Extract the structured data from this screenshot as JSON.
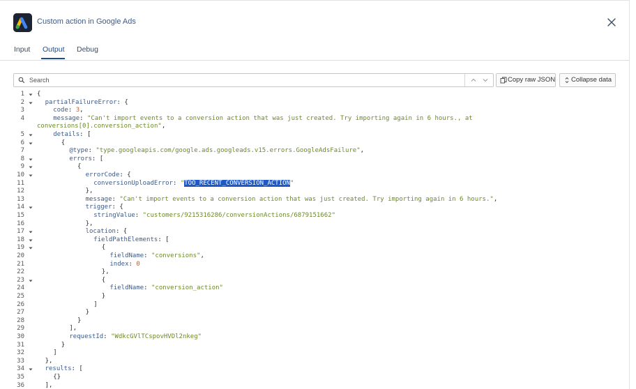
{
  "window": {
    "title": "Custom action in Google Ads",
    "app_icon": "google-ads-icon",
    "close_icon": "close-icon"
  },
  "tabs": [
    {
      "label": "Input",
      "active": false
    },
    {
      "label": "Output",
      "active": true
    },
    {
      "label": "Debug",
      "active": false
    }
  ],
  "toolbar": {
    "search_placeholder": "Search",
    "copy_label": "Copy raw JSON",
    "collapse_label": "Collapse data"
  },
  "colors": {
    "accent": "#1f4d8a",
    "key": "#3c5a87",
    "string": "#6b8a26",
    "number": "#c25b2a",
    "highlight": "#1f59c4"
  },
  "code_lines": [
    {
      "n": "1",
      "fold": true,
      "i": 0,
      "t": [
        [
          "p",
          "{"
        ]
      ]
    },
    {
      "n": "2",
      "fold": true,
      "i": 1,
      "t": [
        [
          "k",
          "partialFailureError"
        ],
        [
          "p",
          ": {"
        ]
      ]
    },
    {
      "n": "3",
      "fold": false,
      "i": 2,
      "t": [
        [
          "k",
          "code"
        ],
        [
          "p",
          ": "
        ],
        [
          "n",
          "3"
        ],
        [
          "p",
          ","
        ]
      ]
    },
    {
      "n": "4",
      "fold": false,
      "i": 2,
      "t": [
        [
          "k",
          "message"
        ],
        [
          "p",
          ": "
        ],
        [
          "s",
          "\"Can't import events to a conversion action that was just created. Try importing again in 6 hours., at"
        ]
      ]
    },
    {
      "n": "",
      "fold": false,
      "i": 0,
      "t": [
        [
          "s",
          "conversions[0].conversion_action\""
        ],
        [
          "p",
          ","
        ]
      ]
    },
    {
      "n": "5",
      "fold": true,
      "i": 2,
      "t": [
        [
          "k",
          "details"
        ],
        [
          "p",
          ": ["
        ]
      ]
    },
    {
      "n": "6",
      "fold": true,
      "i": 3,
      "t": [
        [
          "p",
          "{"
        ]
      ]
    },
    {
      "n": "7",
      "fold": false,
      "i": 4,
      "t": [
        [
          "k",
          "@type"
        ],
        [
          "p",
          ": "
        ],
        [
          "s",
          "\"type.googleapis.com/google.ads.googleads.v15.errors.GoogleAdsFailure\""
        ],
        [
          "p",
          ","
        ]
      ]
    },
    {
      "n": "8",
      "fold": true,
      "i": 4,
      "t": [
        [
          "k",
          "errors"
        ],
        [
          "p",
          ": ["
        ]
      ]
    },
    {
      "n": "9",
      "fold": true,
      "i": 5,
      "t": [
        [
          "p",
          "{"
        ]
      ]
    },
    {
      "n": "10",
      "fold": true,
      "i": 6,
      "t": [
        [
          "k",
          "errorCode"
        ],
        [
          "p",
          ": {"
        ]
      ]
    },
    {
      "n": "11",
      "fold": false,
      "i": 7,
      "t": [
        [
          "k",
          "conversionUploadError"
        ],
        [
          "p",
          ": "
        ],
        [
          "s",
          "\""
        ],
        [
          "h",
          "TOO_RECENT_CONVERSION_ACTION"
        ],
        [
          "s",
          "\""
        ]
      ]
    },
    {
      "n": "12",
      "fold": false,
      "i": 6,
      "t": [
        [
          "p",
          "},"
        ]
      ]
    },
    {
      "n": "13",
      "fold": false,
      "i": 6,
      "t": [
        [
          "k",
          "message"
        ],
        [
          "p",
          ": "
        ],
        [
          "s",
          "\"Can't import events to a conversion action that was just created. Try importing again in 6 hours.\""
        ],
        [
          "p",
          ","
        ]
      ]
    },
    {
      "n": "14",
      "fold": true,
      "i": 6,
      "t": [
        [
          "k",
          "trigger"
        ],
        [
          "p",
          ": {"
        ]
      ]
    },
    {
      "n": "15",
      "fold": false,
      "i": 7,
      "t": [
        [
          "k",
          "stringValue"
        ],
        [
          "p",
          ": "
        ],
        [
          "s",
          "\"customers/9215316286/conversionActions/6879151662\""
        ]
      ]
    },
    {
      "n": "16",
      "fold": false,
      "i": 6,
      "t": [
        [
          "p",
          "},"
        ]
      ]
    },
    {
      "n": "17",
      "fold": true,
      "i": 6,
      "t": [
        [
          "k",
          "location"
        ],
        [
          "p",
          ": {"
        ]
      ]
    },
    {
      "n": "18",
      "fold": true,
      "i": 7,
      "t": [
        [
          "k",
          "fieldPathElements"
        ],
        [
          "p",
          ": ["
        ]
      ]
    },
    {
      "n": "19",
      "fold": true,
      "i": 8,
      "t": [
        [
          "p",
          "{"
        ]
      ]
    },
    {
      "n": "20",
      "fold": false,
      "i": 9,
      "t": [
        [
          "k",
          "fieldName"
        ],
        [
          "p",
          ": "
        ],
        [
          "s",
          "\"conversions\""
        ],
        [
          "p",
          ","
        ]
      ]
    },
    {
      "n": "21",
      "fold": false,
      "i": 9,
      "t": [
        [
          "k",
          "index"
        ],
        [
          "p",
          ": "
        ],
        [
          "n",
          "0"
        ]
      ]
    },
    {
      "n": "22",
      "fold": false,
      "i": 8,
      "t": [
        [
          "p",
          "},"
        ]
      ]
    },
    {
      "n": "23",
      "fold": true,
      "i": 8,
      "t": [
        [
          "p",
          "{"
        ]
      ]
    },
    {
      "n": "24",
      "fold": false,
      "i": 9,
      "t": [
        [
          "k",
          "fieldName"
        ],
        [
          "p",
          ": "
        ],
        [
          "s",
          "\"conversion_action\""
        ]
      ]
    },
    {
      "n": "25",
      "fold": false,
      "i": 8,
      "t": [
        [
          "p",
          "}"
        ]
      ]
    },
    {
      "n": "26",
      "fold": false,
      "i": 7,
      "t": [
        [
          "p",
          "]"
        ]
      ]
    },
    {
      "n": "27",
      "fold": false,
      "i": 6,
      "t": [
        [
          "p",
          "}"
        ]
      ]
    },
    {
      "n": "28",
      "fold": false,
      "i": 5,
      "t": [
        [
          "p",
          "}"
        ]
      ]
    },
    {
      "n": "29",
      "fold": false,
      "i": 4,
      "t": [
        [
          "p",
          "],"
        ]
      ]
    },
    {
      "n": "30",
      "fold": false,
      "i": 4,
      "t": [
        [
          "k",
          "requestId"
        ],
        [
          "p",
          ": "
        ],
        [
          "s",
          "\"WdkcGVlTCspovHVDl2nkeg\""
        ]
      ]
    },
    {
      "n": "31",
      "fold": false,
      "i": 3,
      "t": [
        [
          "p",
          "}"
        ]
      ]
    },
    {
      "n": "32",
      "fold": false,
      "i": 2,
      "t": [
        [
          "p",
          "]"
        ]
      ]
    },
    {
      "n": "33",
      "fold": false,
      "i": 1,
      "t": [
        [
          "p",
          "},"
        ]
      ]
    },
    {
      "n": "34",
      "fold": true,
      "i": 1,
      "t": [
        [
          "k",
          "results"
        ],
        [
          "p",
          ": ["
        ]
      ]
    },
    {
      "n": "35",
      "fold": false,
      "i": 2,
      "t": [
        [
          "p",
          "{}"
        ]
      ]
    },
    {
      "n": "36",
      "fold": false,
      "i": 1,
      "t": [
        [
          "p",
          "],"
        ]
      ]
    }
  ]
}
